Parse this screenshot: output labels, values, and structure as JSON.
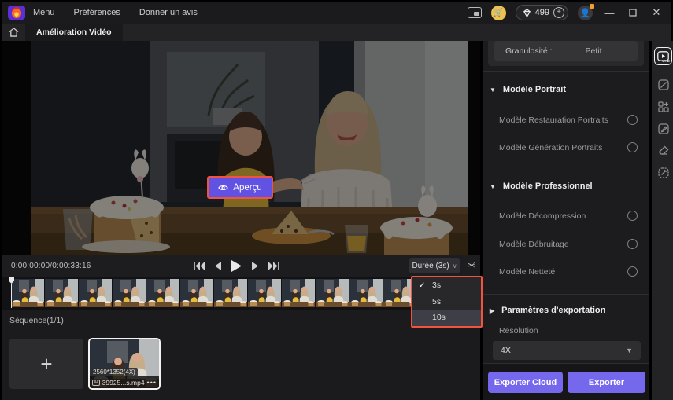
{
  "titlebar": {
    "menu": [
      {
        "label": "Menu"
      },
      {
        "label": "Préférences"
      },
      {
        "label": "Donner un avis"
      }
    ],
    "credits": "499"
  },
  "tabbar": {
    "active_tab": "Amélioration Vidéo"
  },
  "player": {
    "preview_button": "Aperçu",
    "timecode": "0:00:00:00/0:00:33:16",
    "duration_button": "Durée (3s)",
    "duration_menu": {
      "items": [
        {
          "label": "3s",
          "checked": true
        },
        {
          "label": "5s",
          "checked": false
        },
        {
          "label": "10s",
          "checked": false,
          "highlighted": true
        }
      ]
    }
  },
  "timeline": {
    "frame_count": 14
  },
  "sequence": {
    "title": "Séquence(1/1)",
    "add_label": "+",
    "clip": {
      "resolution_badge": "2560*1352(4X)",
      "ai_badge": "AI",
      "filename": "39925...s.mp4",
      "more": "•••"
    }
  },
  "sidebar": {
    "granularity": {
      "label": "Granulosité :",
      "value": "Petit"
    },
    "sections": [
      {
        "title": "Modèle Portrait",
        "options": [
          {
            "label": "Modèle Restauration Portraits"
          },
          {
            "label": "Modèle Génération Portraits"
          }
        ]
      },
      {
        "title": "Modèle Professionnel",
        "options": [
          {
            "label": "Modèle Décompression"
          },
          {
            "label": "Modèle Débruitage"
          },
          {
            "label": "Modèle Netteté"
          }
        ]
      }
    ],
    "export_section": {
      "title": "Paramètres d'exportation",
      "resolution_label": "Résolution",
      "resolution_value": "4X"
    },
    "buttons": {
      "cloud": "Exporter Cloud",
      "export": "Exporter"
    }
  },
  "colors": {
    "accent_purple": "#7668ec",
    "preview_purple": "#6152e4",
    "annotation_red": "#f2533f",
    "coin_yellow": "#eec24e"
  }
}
